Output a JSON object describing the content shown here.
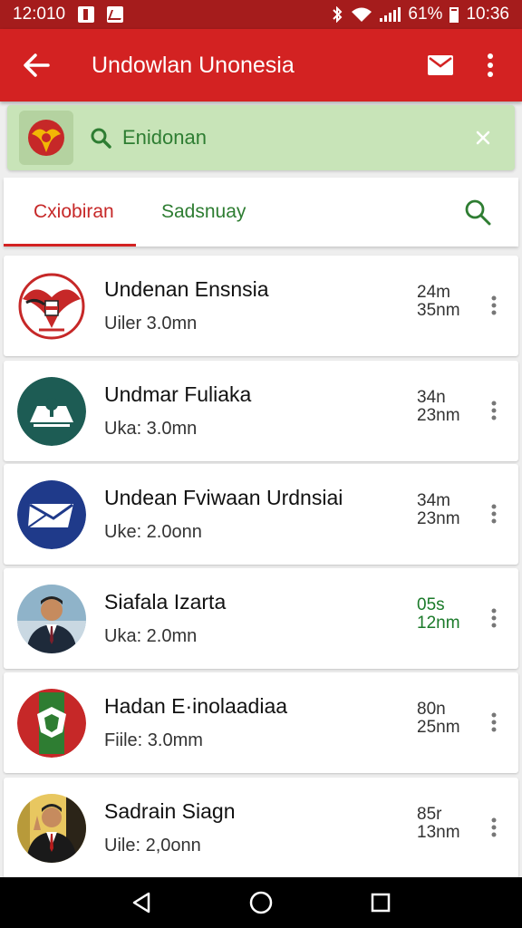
{
  "status_bar": {
    "time_left": "12:010",
    "battery": "61%",
    "time_right": "10:36"
  },
  "app_bar": {
    "title": "Undowlan Unonesia",
    "back_icon": "arrow-back-icon",
    "mail_icon": "mail-icon",
    "more_icon": "more-vert-icon"
  },
  "search": {
    "query": "Enidonan",
    "icon": "search-icon",
    "clear_icon": "close-icon"
  },
  "tabs": [
    {
      "label": "Cxiobiran",
      "active": true
    },
    {
      "label": "Sadsnuay",
      "active": false
    }
  ],
  "colors": {
    "primary": "#d32222",
    "status_bar": "#a51c1c",
    "accent_green": "#2e7d32",
    "search_bg": "#c8e4b8"
  },
  "items": [
    {
      "title": "Undenan Ensnsia",
      "subtitle": "Uiler 3.0mn",
      "meta1": "24m",
      "meta2": "35nm",
      "avatar": "garuda-crest-avatar"
    },
    {
      "title": "Undmar Fuliaka",
      "subtitle": "Uka: 3.0mn",
      "meta1": "34n",
      "meta2": "23nm",
      "avatar": "building-avatar"
    },
    {
      "title": "Undean Fviwaan Urdnsiai",
      "subtitle": "Uke: 2.0onn",
      "meta1": "34m",
      "meta2": "23nm",
      "avatar": "envelope-avatar"
    },
    {
      "title": "Siafala Izarta",
      "subtitle": "Uka: 2.0mn",
      "meta1": "05s",
      "meta2": "12nm",
      "avatar": "person-photo-avatar",
      "highlight": true
    },
    {
      "title": "Hadan E·inolaadiaa",
      "subtitle": "Fiile: 3.0mm",
      "meta1": "80n",
      "meta2": "25nm",
      "avatar": "green-emblem-avatar"
    },
    {
      "title": "Sadrain Siagn",
      "subtitle": "Uile: 2,0onn",
      "meta1": "85r",
      "meta2": "13nm",
      "avatar": "person-photo-avatar"
    }
  ],
  "nav": {
    "back_icon": "nav-back-icon",
    "home_icon": "nav-home-icon",
    "recents_icon": "nav-recents-icon"
  }
}
